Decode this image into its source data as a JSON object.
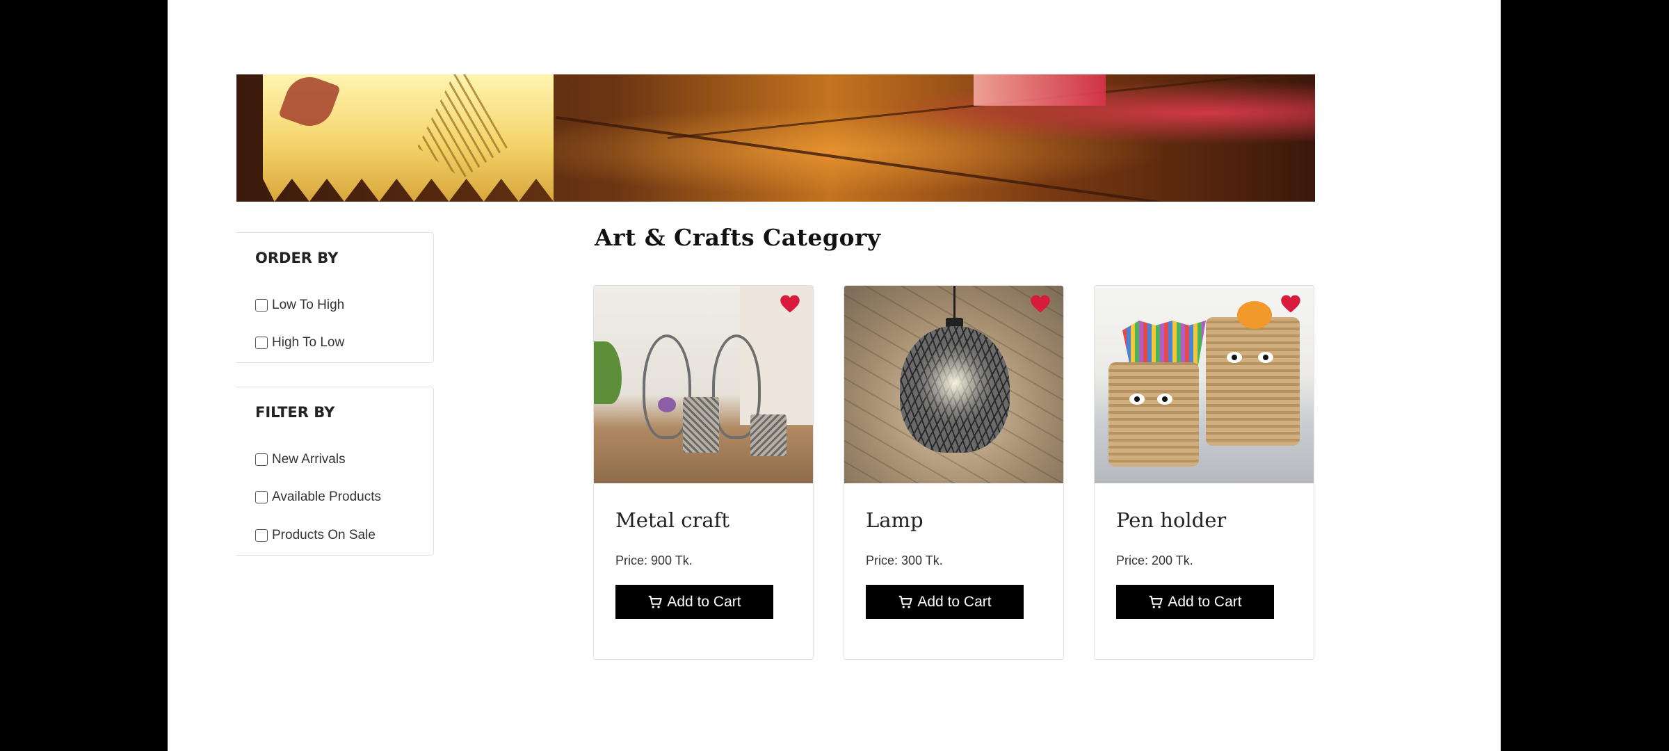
{
  "sidebar": {
    "order_by": {
      "title": "ORDER BY",
      "options": [
        "Low To High",
        "High To Low"
      ]
    },
    "filter_by": {
      "title": "FILTER BY",
      "options": [
        "New Arrivals",
        "Available Products",
        "Products On Sale"
      ]
    }
  },
  "main": {
    "category_title": "Art & Crafts Category",
    "products": [
      {
        "name": "Metal craft",
        "price": "Price: 900 Tk.",
        "cta": "Add to Cart"
      },
      {
        "name": "Lamp",
        "price": "Price: 300 Tk.",
        "cta": "Add to Cart"
      },
      {
        "name": "Pen holder",
        "price": "Price: 200 Tk.",
        "cta": "Add to Cart"
      }
    ]
  },
  "colors": {
    "heart": "#d81b3c",
    "button_bg": "#000000",
    "button_text": "#ffffff"
  },
  "icons": {
    "wishlist": "heart-icon",
    "cart": "cart-icon"
  }
}
